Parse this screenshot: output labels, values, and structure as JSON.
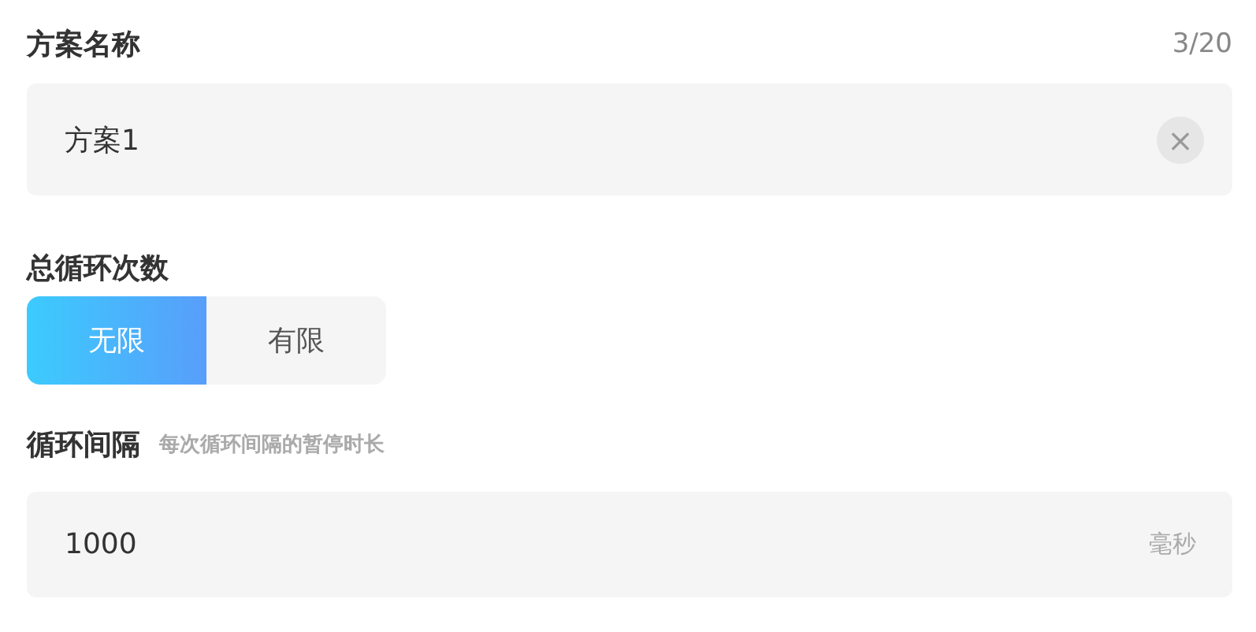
{
  "name_section": {
    "label": "方案名称",
    "counter": "3/20",
    "value": "方案1",
    "clear_icon": "×"
  },
  "loop_count": {
    "label": "总循环次数",
    "options": [
      {
        "label": "无限",
        "selected": true
      },
      {
        "label": "有限",
        "selected": false
      }
    ]
  },
  "interval": {
    "label": "循环间隔",
    "hint": "每次循环间隔的暂停时长",
    "value": "1000",
    "unit": "毫秒"
  }
}
